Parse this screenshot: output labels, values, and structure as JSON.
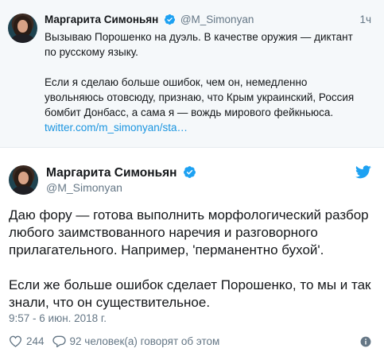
{
  "top_tweet": {
    "author_name": "Маргарита Симоньян",
    "author_handle": "@M_Simonyan",
    "relative_time": "1ч",
    "line_1": "Вызываю Порошенко на дуэль. В качестве оружия — диктант",
    "line_2": "по русскому языку.",
    "line_3": "Если я сделаю больше ошибок, чем он, немедленно",
    "line_4": "увольняюсь отовсюду, признаю, что Крым украинский, Россия",
    "line_5": "бомбит Донбасс, а сама я — вождь мирового фейкньюса.",
    "link": "twitter.com/m_simonyan/sta…"
  },
  "main_tweet": {
    "author_name": "Маргарита Симоньян",
    "author_handle": "@M_Simonyan",
    "line_1": "Даю фору — готова выполнить морфологический разбор",
    "line_2": "любого заимствованного наречия и разговорного",
    "line_3": "прилагательного. Например, 'перманентно бухой'.",
    "line_4": "Если же больше ошибок сделает Порошенко, то мы и так",
    "line_5": "знали, что он существительное.",
    "timestamp": "9:57 - 6 июн. 2018 г.",
    "likes": "244",
    "replies_text": "92 человек(а) говорят об этом"
  },
  "icons": {
    "verified": "verified-badge-icon",
    "bird": "twitter-bird-icon",
    "heart": "heart-icon",
    "comment": "comment-icon",
    "info": "info-icon"
  },
  "colors": {
    "accent": "#1da1f2",
    "link": "#1b95e0",
    "muted": "#657786",
    "top_bg": "#f5f8fa"
  }
}
